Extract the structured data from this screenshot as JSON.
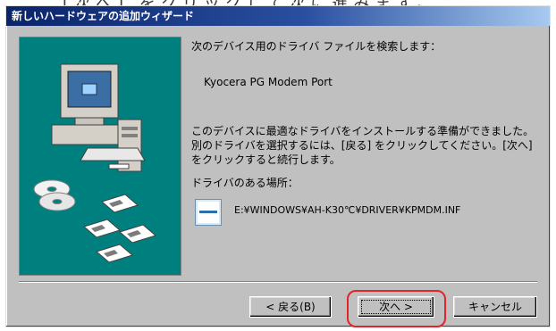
{
  "page": {
    "top_text": "[次へ] をクリックして次に進みます。"
  },
  "window": {
    "title": "新しいハードウェアの追加ウィザード"
  },
  "content": {
    "heading": "次のデバイス用のドライバ ファイルを検索します：",
    "device_name": "Kyocera PG Modem Port",
    "paragraph": "このデバイスに最適なドライバをインストールする準備ができました。別のドライバを選択するには、[戻る] をクリックしてください。[次へ] をクリックすると続行します。",
    "location_label": "ドライバのある場所：",
    "driver_path": "E:¥WINDOWS¥AH-K30℃¥DRIVER¥KPMDM.INF"
  },
  "buttons": {
    "back": "< 戻る(B)",
    "next": "次へ >",
    "cancel": "キャンセル"
  },
  "colors": {
    "title_bar": "#0a246a",
    "dialog_face": "#c0c0c0",
    "art_background": "#007f7f",
    "highlight": "#e0262b"
  },
  "icons": {
    "computer": "computer-icon",
    "cd": "cd-disc-icon",
    "floppy": "floppy-disk-icon",
    "driver_file": "driver-file-icon"
  }
}
